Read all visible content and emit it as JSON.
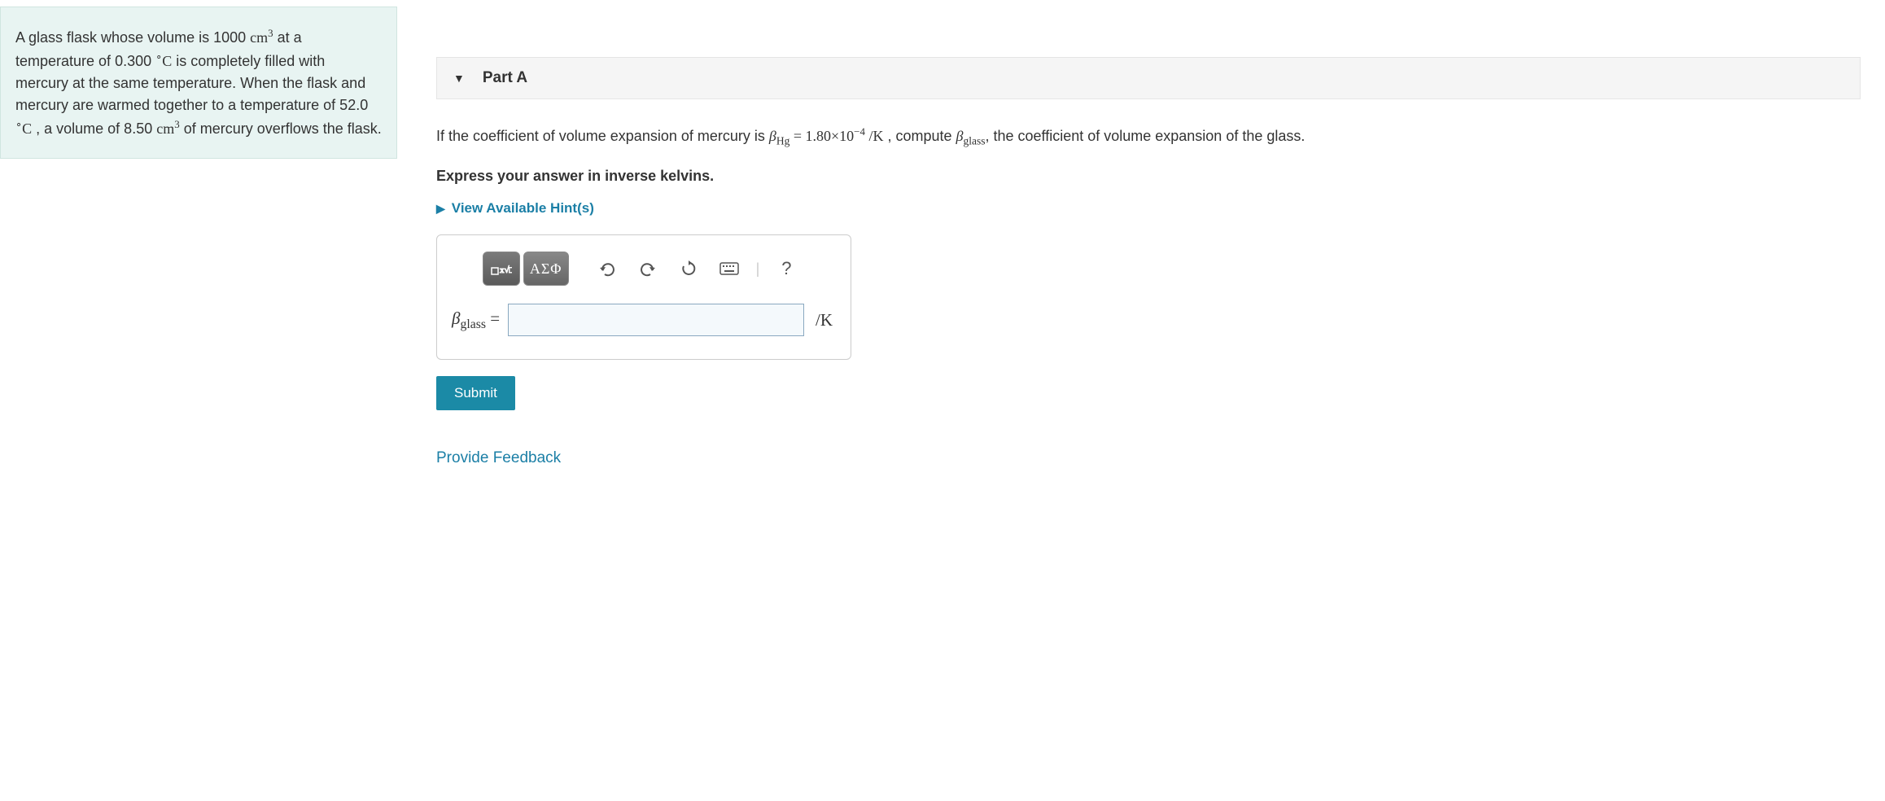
{
  "problem": {
    "pre1": "A glass flask whose volume is 1000 ",
    "unit1": "cm",
    "sup1": "3",
    "pre2": " at a temperature of 0.300 ",
    "degC1": "∘C",
    "mid1": " is completely filled with mercury at the same temperature. When the flask and mercury are warmed together to a temperature of 52.0 ",
    "degC2": "∘C",
    "mid2": " , a volume of 8.50 ",
    "unit2": "cm",
    "sup2": "3",
    "post": " of mercury overflows the flask."
  },
  "part": {
    "label": "Part A"
  },
  "question": {
    "pre": "If the coefficient of volume expansion of mercury is ",
    "betaHg_sym": "β",
    "betaHg_sub": "Hg",
    "eq": " = 1.80×10",
    "exp": "−4",
    "perK": " /K",
    "mid": " , compute ",
    "betaG_sym": "β",
    "betaG_sub": "glass",
    "post": ", the coefficient of volume expansion of the glass."
  },
  "instruction": "Express your answer in inverse kelvins.",
  "hints_label": "View Available Hint(s)",
  "toolbar": {
    "greek_label": "ΑΣΦ"
  },
  "answer": {
    "beta_sym": "β",
    "beta_sub": "glass",
    "equals": " = ",
    "value": "",
    "unit": "/K"
  },
  "submit_label": "Submit",
  "feedback_label": "Provide Feedback"
}
